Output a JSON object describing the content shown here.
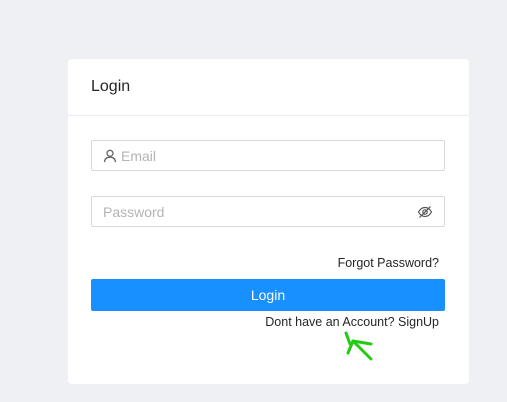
{
  "login_card": {
    "title": "Login",
    "email": {
      "placeholder": "Email",
      "value": "",
      "icon": "user-icon"
    },
    "password": {
      "placeholder": "Password",
      "value": "",
      "icon": "eye-slash-icon"
    },
    "forgot_password_label": "Forgot Password?",
    "login_button_label": "Login",
    "signup_prompt": "Dont have an Account?",
    "signup_link_label": "SignUp"
  },
  "colors": {
    "page_background": "#eef0f4",
    "card_background": "#ffffff",
    "primary": "#1890ff",
    "annotation_arrow": "#22cc11"
  }
}
